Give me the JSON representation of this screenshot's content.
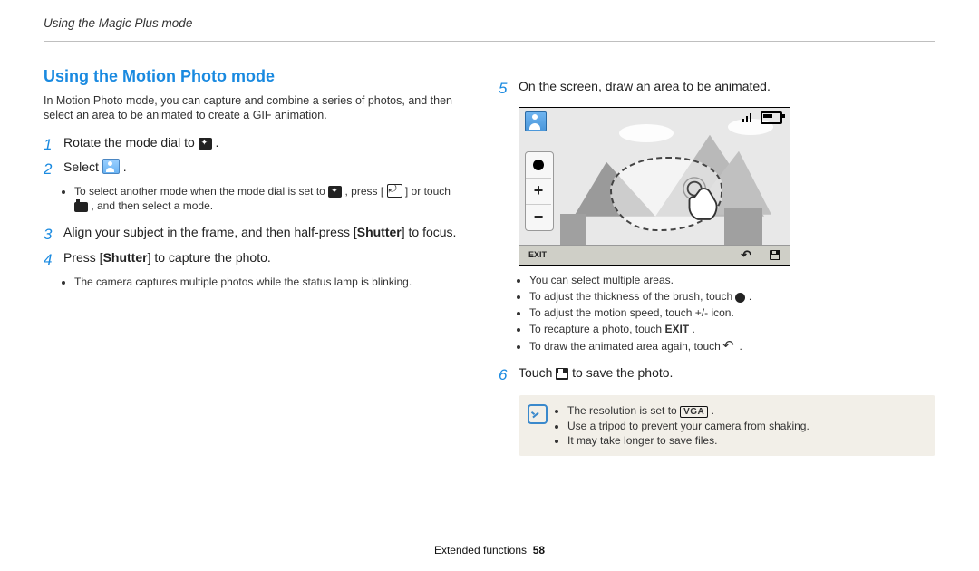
{
  "header": {
    "breadcrumb": "Using the Magic Plus mode"
  },
  "left": {
    "title": "Using the Motion Photo mode",
    "intro": "In Motion Photo mode, you can capture and combine a series of photos, and then select an area to be animated to create a GIF animation.",
    "step1": {
      "num": "1",
      "before": "Rotate the mode dial to ",
      "after": "."
    },
    "step2": {
      "num": "2",
      "before": "Select ",
      "after": "."
    },
    "step2_tip": {
      "before": "To select another mode when the mode dial is set to ",
      "mid": ", press [",
      "after": "] or touch ",
      "end": ", and then select a mode."
    },
    "step3": {
      "num": "3",
      "before": "Align your subject in the frame, and then half-press [",
      "bold": "Shutter",
      "after": "] to focus."
    },
    "step4": {
      "num": "4",
      "before": "Press [",
      "bold": "Shutter",
      "after": "] to capture the photo."
    },
    "step4_tip": "The camera captures multiple photos while the status lamp is blinking."
  },
  "right": {
    "step5": {
      "num": "5",
      "text": "On the screen, draw an area to be animated."
    },
    "screen": {
      "exit_label": "EXIT",
      "plus": "+",
      "minus": "−"
    },
    "bullets": {
      "b1": "You can select multiple areas.",
      "b2_before": "To adjust the thickness of the brush, touch ",
      "b2_after": ".",
      "b3": "To adjust the motion speed, touch +/- icon.",
      "b4_before": "To recapture a photo, touch ",
      "b4_bold": "EXIT",
      "b4_after": ".",
      "b5_before": "To draw the animated area again, touch ",
      "b5_after": "."
    },
    "step6": {
      "num": "6",
      "before": "Touch ",
      "after": " to save the photo."
    },
    "note": {
      "n1_before": "The resolution is set to ",
      "n1_bold": "VGA",
      "n1_after": ".",
      "n2": "Use a tripod to prevent your camera from shaking.",
      "n3": "It may take longer to save files."
    }
  },
  "footer": {
    "section": "Extended functions",
    "page": "58"
  }
}
